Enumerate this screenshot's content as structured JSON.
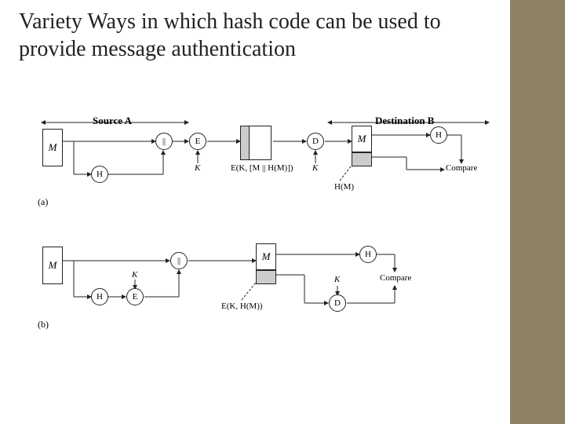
{
  "title": "Variety Ways in which hash code can be used to provide message authentication",
  "headers": {
    "source": "Source A",
    "dest": "Destination B"
  },
  "nodes": {
    "M": "M",
    "H": "H",
    "E": "E",
    "D": "D",
    "concat": "||",
    "compare": "Compare",
    "K": "K",
    "cipher_a": "E(K, [M || H(M)])",
    "cipher_b": "E(K, H(M))",
    "HM": "H(M)"
  },
  "parts": {
    "a": "(a)",
    "b": "(b)"
  }
}
